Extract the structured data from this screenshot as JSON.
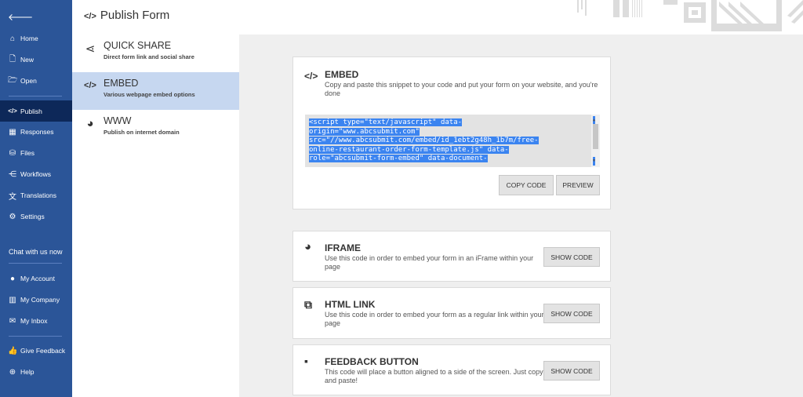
{
  "sidebar": {
    "items": [
      {
        "label": "Home",
        "icon": "home-icon",
        "glyph": "⌂"
      },
      {
        "label": "New",
        "icon": "new-file-icon",
        "glyph": "🗋"
      },
      {
        "label": "Open",
        "icon": "folder-open-icon",
        "glyph": "🗁"
      },
      {
        "label": "Publish",
        "icon": "code-icon",
        "glyph": "</>"
      },
      {
        "label": "Responses",
        "icon": "responses-icon",
        "glyph": "▦"
      },
      {
        "label": "Files",
        "icon": "files-icon",
        "glyph": "⛁"
      },
      {
        "label": "Workflows",
        "icon": "workflows-icon",
        "glyph": "⋲"
      },
      {
        "label": "Translations",
        "icon": "translate-icon",
        "glyph": "文"
      },
      {
        "label": "Settings",
        "icon": "gear-icon",
        "glyph": "⚙"
      }
    ],
    "chat": "Chat with us now",
    "account_items": [
      {
        "label": "My Account",
        "icon": "account-icon",
        "glyph": "●"
      },
      {
        "label": "My Company",
        "icon": "company-icon",
        "glyph": "▥"
      },
      {
        "label": "My Inbox",
        "icon": "mail-icon",
        "glyph": "✉"
      }
    ],
    "bottom_items": [
      {
        "label": "Give Feedback",
        "icon": "thumbs-up-icon",
        "glyph": "👍"
      },
      {
        "label": "Help",
        "icon": "help-icon",
        "glyph": "⊕"
      }
    ]
  },
  "header": {
    "title": "Publish Form"
  },
  "options": [
    {
      "title": "QUICK SHARE",
      "desc": "Direct form link and social share",
      "glyph": "⋖"
    },
    {
      "title": "EMBED",
      "desc": "Various webpage embed options",
      "glyph": "</>"
    },
    {
      "title": "WWW",
      "desc": "Publish on internet domain",
      "glyph": "◕"
    }
  ],
  "embed": {
    "title": "EMBED",
    "desc": "Copy and paste this snippet to your code and put your form on your website, and you're done",
    "code_lines": [
      "<script type=\"text/javascript\" data-",
      "origin=\"www.abcsubmit.com\"",
      "src=\"//www.abcsubmit.com/embed/id_1ebt2g48h_1b7m/free-",
      "online-restaurant-order-form-template.js\" data-",
      "role=\"abcsubmit-form-embed\" data-document-"
    ],
    "copy_label": "COPY CODE",
    "preview_label": "PREVIEW"
  },
  "cards": [
    {
      "title": "IFRAME",
      "desc": "Use this code in order to embed your form in an iFrame within your page",
      "button": "SHOW CODE",
      "glyph": "◕"
    },
    {
      "title": "HTML LINK",
      "desc": "Use this code in order to embed your form as a regular link within your page",
      "button": "SHOW CODE",
      "glyph": "⧉"
    },
    {
      "title": "FEEDBACK BUTTON",
      "desc": "This code will place a button aligned to a side of the screen. Just copy and paste!",
      "button": "SHOW CODE",
      "glyph": "▪"
    }
  ],
  "colors": {
    "sidebar": "#2b5598",
    "active": "#0d2859",
    "selection": "#3b84f0"
  }
}
